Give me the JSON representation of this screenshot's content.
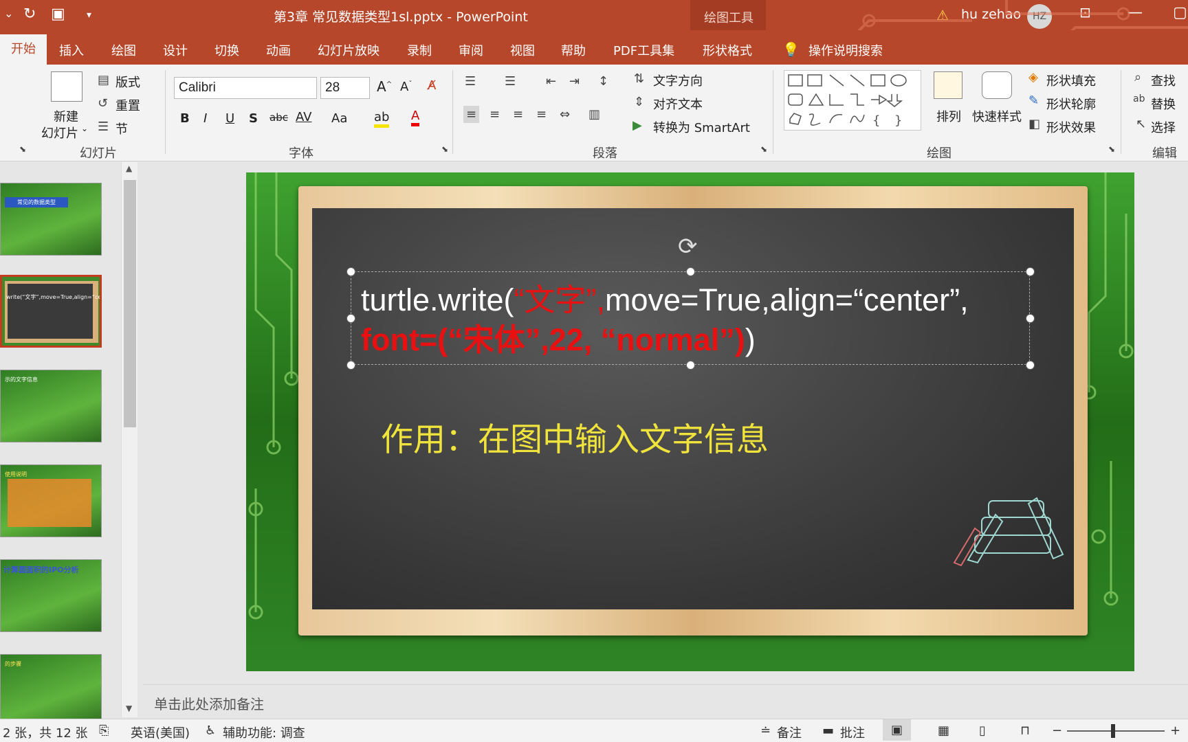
{
  "title_bar": {
    "doc_title": "第3章  常见数据类型1sl.pptx  -  PowerPoint",
    "context_label": "绘图工具",
    "user_name": "hu zehao",
    "user_initials": "HZ"
  },
  "tabs": [
    "开始",
    "插入",
    "绘图",
    "设计",
    "切换",
    "动画",
    "幻灯片放映",
    "录制",
    "审阅",
    "视图",
    "帮助",
    "PDF工具集",
    "形状格式"
  ],
  "tell_me": "操作说明搜索",
  "ribbon": {
    "slides_group": {
      "new_slide": "新建",
      "new_slide2": "幻灯片",
      "layout": "版式",
      "reset": "重置",
      "section": "节",
      "label": "幻灯片"
    },
    "font_group": {
      "font_name": "Calibri",
      "font_size": "28",
      "label": "字体",
      "bold": "B",
      "italic": "I",
      "underline": "U",
      "shadow": "S",
      "strike": "abc",
      "spacing": "AV",
      "case": "Aa"
    },
    "paragraph_group": {
      "text_direction": "文字方向",
      "align_text": "对齐文本",
      "smartart": "转换为 SmartArt",
      "label": "段落"
    },
    "drawing_group": {
      "arrange": "排列",
      "quick_styles": "快速样式",
      "fill": "形状填充",
      "outline": "形状轮廓",
      "effects": "形状效果",
      "label": "绘图"
    },
    "editing_group": {
      "find": "查找",
      "replace": "替换",
      "select": "选择",
      "label": "编辑"
    }
  },
  "thumbnails": [
    {
      "text": "常见的数据类型"
    },
    {
      "text": "write(“文字”,move=True,align=“center”,"
    },
    {
      "text": "示的文字信息"
    },
    {
      "text": "使用说明"
    },
    {
      "text": "计算圆面积的IPO分析"
    },
    {
      "text": "的步骤"
    }
  ],
  "slide": {
    "code_line1_a": "turtle.write(",
    "code_line1_b": "“文字”,",
    "code_line1_c": "move=True,align=“center”,",
    "code_line2_a": "font=(“宋体”,22, “normal”)",
    "code_line2_b": ")",
    "caption": "作用：在图中输入文字信息"
  },
  "notes_placeholder": "单击此处添加备注",
  "status_bar": {
    "slide_info": "2 张，共 12 张",
    "language": "英语(美国)",
    "accessibility": "辅助功能: 调查",
    "notes_btn": "备注",
    "comments_btn": "批注"
  },
  "colors": {
    "accent": "#b7472a",
    "code_red": "#e81010",
    "caption_yellow": "#f0e33c"
  }
}
